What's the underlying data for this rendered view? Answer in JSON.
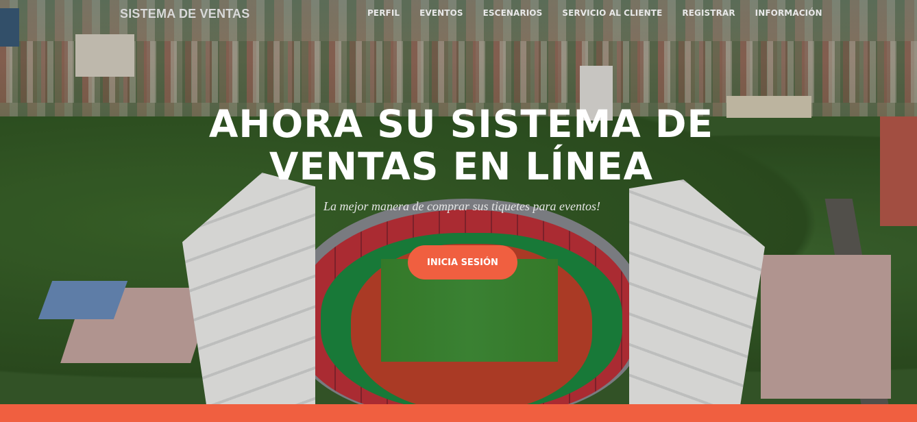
{
  "nav": {
    "brand": "SISTEMA DE VENTAS",
    "links": [
      "PERFIL",
      "EVENTOS",
      "ESCENARIOS",
      "SERVICIO AL CLIENTE",
      "REGISTRAR",
      "INFORMACIÓN"
    ]
  },
  "hero": {
    "headline_line1": "AHORA SU SISTEMA DE",
    "headline_line2": "VENTAS EN LÍNEA",
    "subheadline": "La mejor manera de comprar sus tiquetes para eventos!",
    "cta_label": "INICIA SESIÓN"
  },
  "colors": {
    "accent": "#f05f40",
    "nav_text": "#e8e8e8",
    "headline": "#ffffff"
  }
}
